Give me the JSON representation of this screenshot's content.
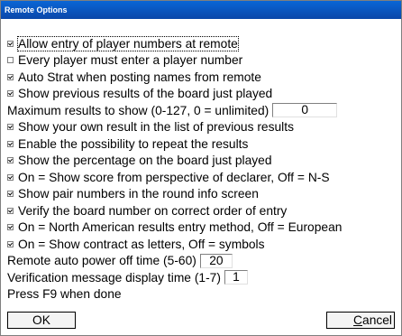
{
  "window": {
    "title": "Remote Options"
  },
  "options": [
    {
      "label": "Allow entry of player numbers at remote",
      "checked": true
    },
    {
      "label": "Every player must enter a player number",
      "checked": false
    },
    {
      "label": "Auto Strat when posting names from remote",
      "checked": true
    },
    {
      "label": "Show previous results of the board just played",
      "checked": true
    }
  ],
  "max_results": {
    "label": "Maximum results to show (0-127, 0 = unlimited)",
    "value": "0"
  },
  "options2": [
    {
      "label": "Show your own result in the list of previous results",
      "checked": true
    },
    {
      "label": "Enable the possibility to repeat the results",
      "checked": true
    },
    {
      "label": "Show the percentage on the board just played",
      "checked": true
    },
    {
      "label": "On = Show score from perspective of declarer, Off = N-S",
      "checked": true
    },
    {
      "label": "Show pair numbers in the round info screen",
      "checked": true
    },
    {
      "label": "Verify the board number on correct order of entry",
      "checked": true
    },
    {
      "label": "On = North American results entry method, Off = European",
      "checked": true
    },
    {
      "label": "On = Show contract as letters, Off = symbols",
      "checked": true
    }
  ],
  "power_off": {
    "label": "Remote auto power off time (5-60)",
    "value": "20"
  },
  "verify_time": {
    "label": "Verification message display time (1-7)",
    "value": "1"
  },
  "hint": "Press F9 when done",
  "buttons": {
    "ok": "OK",
    "cancel_first": "C",
    "cancel_rest": "ancel"
  }
}
